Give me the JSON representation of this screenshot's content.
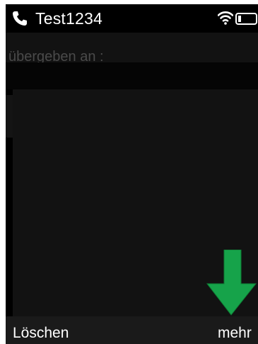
{
  "status_bar": {
    "device_name": "Test1234",
    "phone_icon": "phone-handset-icon",
    "wifi_icon": "wifi-icon",
    "battery_icon": "battery-icon"
  },
  "header": {
    "transfer_label": "übergeben an :"
  },
  "softkeys": {
    "left_label": "Löschen",
    "right_label": "mehr"
  },
  "annotation": {
    "arrow_icon": "green-down-arrow-icon",
    "arrow_color": "#16a34a"
  },
  "colors": {
    "screen_background": "#000000",
    "softkey_bar": "#1a1a1a",
    "dim_text": "#4a4a4a"
  }
}
